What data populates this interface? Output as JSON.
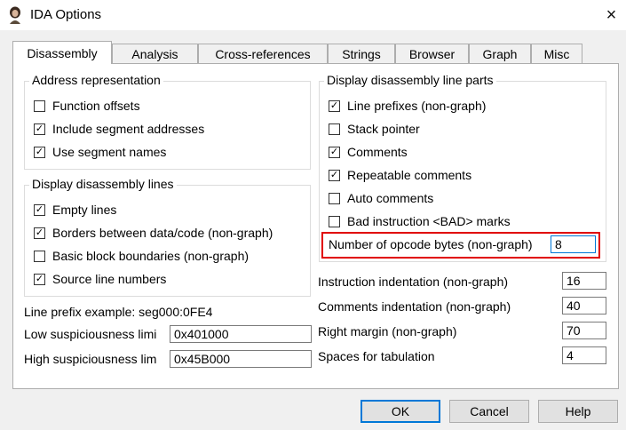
{
  "window": {
    "title": "IDA Options",
    "close_icon": "×"
  },
  "tabs": [
    {
      "label": "Disassembly"
    },
    {
      "label": "Analysis"
    },
    {
      "label": "Cross-references"
    },
    {
      "label": "Strings"
    },
    {
      "label": "Browser"
    },
    {
      "label": "Graph"
    },
    {
      "label": "Misc"
    }
  ],
  "address_representation": {
    "title": "Address representation",
    "items": [
      {
        "label": "Function offsets",
        "checked": false
      },
      {
        "label": "Include segment addresses",
        "checked": true
      },
      {
        "label": "Use segment names",
        "checked": true
      }
    ]
  },
  "display_lines": {
    "title": "Display disassembly lines",
    "items": [
      {
        "label": "Empty lines",
        "checked": true
      },
      {
        "label": "Borders between data/code (non-graph)",
        "checked": true
      },
      {
        "label": "Basic block boundaries (non-graph)",
        "checked": false
      },
      {
        "label": "Source line numbers",
        "checked": true
      }
    ]
  },
  "line_parts": {
    "title": "Display disassembly line parts",
    "items": [
      {
        "label": "Line prefixes (non-graph)",
        "checked": true
      },
      {
        "label": "Stack pointer",
        "checked": false
      },
      {
        "label": "Comments",
        "checked": true
      },
      {
        "label": "Repeatable comments",
        "checked": true
      },
      {
        "label": "Auto comments",
        "checked": false
      },
      {
        "label": "Bad instruction <BAD> marks",
        "checked": false
      }
    ],
    "opcode_label": "Number of opcode bytes (non-graph)",
    "opcode_value": "8"
  },
  "prefix_example": "Line prefix example: seg000:0FE4",
  "low_susp": {
    "label": "Low suspiciousness limi",
    "value": "0x401000"
  },
  "high_susp": {
    "label": "High suspiciousness lim",
    "value": "0x45B000"
  },
  "right_fields": [
    {
      "label": "Instruction indentation (non-graph)",
      "value": "16"
    },
    {
      "label": "Comments indentation (non-graph)",
      "value": "40"
    },
    {
      "label": "Right margin (non-graph)",
      "value": "70"
    },
    {
      "label": "Spaces for tabulation",
      "value": "4"
    }
  ],
  "buttons": {
    "ok": "OK",
    "cancel": "Cancel",
    "help": "Help"
  },
  "colors": {
    "highlight": "#e00000",
    "focus": "#0078d7"
  }
}
